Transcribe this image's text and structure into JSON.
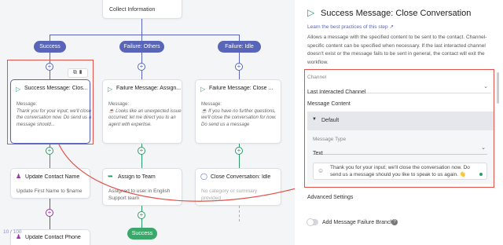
{
  "canvas": {
    "collect_node": {
      "title": "Collect Information"
    },
    "branches": {
      "success": "Success",
      "failure_others": "Failure: Others",
      "failure_idle": "Failure: Idle"
    },
    "nodes": {
      "success_msg": {
        "title": "Success Message: Clos...",
        "label": "Message:",
        "body": "Thank you for your input; we'll close the conversation now. Do send us a message should..."
      },
      "failure_assign": {
        "title": "Failure Message: Assign...",
        "label": "Message:",
        "body": "☕ Looks like an unexpected issue occurred; let me direct you to an agent with expertise."
      },
      "failure_close": {
        "title": "Failure Message: Close ...",
        "label": "Message:",
        "body": "☕ If you have no further questions, we'll close the conversation for now. Do send us a message"
      },
      "update_contact": {
        "title": "Update Contact Name",
        "body": "Update First Name to $name"
      },
      "assign_team": {
        "title": "Assign to Team",
        "body": "Assigned to user in English Support team"
      },
      "close_idle": {
        "title": "Close Conversation: Idle",
        "body": "No category or summary provided"
      },
      "update_phone": {
        "title": "Update Contact Phone"
      }
    },
    "success_end": "Success",
    "counter": "10 / 100"
  },
  "panel": {
    "title": "Success Message: Close Conversation",
    "learn_link": "Learn the best practices of this step",
    "description": "Allows a message with the specified content to be sent to the contact. Channel-specific content can be specified when necessary. If the last interacted channel doesn't exist or the message fails to be sent in general, the contact will exit the workflow.",
    "channel_label": "Channel",
    "channel_value": "Last Interacted Channel",
    "content_label": "Message Content",
    "default_label": "Default",
    "type_label": "Message Type",
    "type_value": "Text",
    "message_text": "Thank you for your input; we'll close the conversation now. Do send us a message should you like to speak to us again. 👋",
    "advanced_label": "Advanced Settings",
    "failure_branch_label": "Add Message Failure Branch"
  },
  "colors": {
    "accent": "#5865b8",
    "green": "#2f9a68",
    "purple": "#9b33a6",
    "highlight": "#e0524a"
  }
}
